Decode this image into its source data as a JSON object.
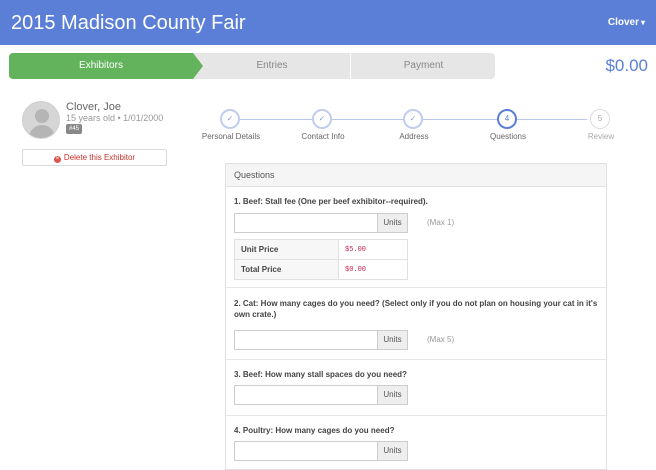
{
  "header": {
    "title": "2015 Madison County Fair",
    "user_menu": "Clover",
    "caret": "▾"
  },
  "flow_steps": [
    {
      "label": "Exhibitors",
      "state": "active"
    },
    {
      "label": "Entries",
      "state": "inactive"
    },
    {
      "label": "Payment",
      "state": "inactive"
    }
  ],
  "cart_total": "$0.00",
  "exhibitor": {
    "name": "Clover, Joe",
    "meta": "15 years old • 1/01/2000",
    "badge": "#45",
    "delete_label": "Delete this Exhibitor",
    "delete_icon": "×"
  },
  "wizard": {
    "steps": [
      {
        "label": "Personal Details",
        "marker": "✓",
        "state": "done"
      },
      {
        "label": "Contact Info",
        "marker": "✓",
        "state": "done"
      },
      {
        "label": "Address",
        "marker": "✓",
        "state": "done"
      },
      {
        "label": "Questions",
        "marker": "4",
        "state": "current"
      },
      {
        "label": "Review",
        "marker": "5",
        "state": "future"
      }
    ]
  },
  "questions": {
    "heading": "Questions",
    "items": [
      {
        "title": "1. Beef: Stall fee (One per beef exhibitor--required).",
        "value": "",
        "units": "Units",
        "max": "(Max 1)",
        "unit_price_label": "Unit Price",
        "unit_price": "$5.00",
        "total_price_label": "Total Price",
        "total_price": "$0.00"
      },
      {
        "title": "2. Cat: How many cages do you need? (Select only if you do not plan on housing your cat in it's own crate.)",
        "value": "",
        "units": "Units",
        "max": "(Max 5)"
      },
      {
        "title": "3. Beef: How many stall spaces do you need?",
        "value": "",
        "units": "Units"
      },
      {
        "title": "4. Poultry: How many cages do you need?",
        "value": "",
        "units": "Units"
      }
    ]
  },
  "colors": {
    "brand": "#5b7fd6",
    "active_step": "#62b35c",
    "danger": "#d9534f"
  }
}
